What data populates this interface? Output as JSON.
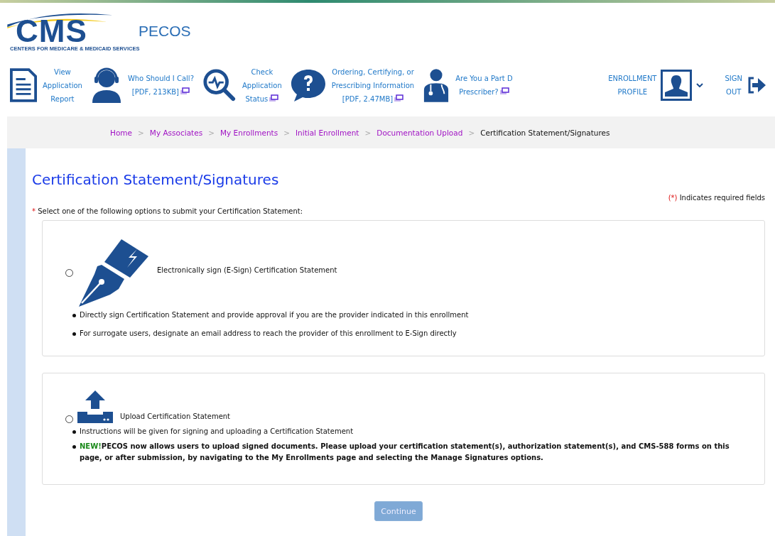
{
  "logo": {
    "letters": "CMS",
    "tagline": "CENTERS FOR MEDICARE & MEDICAID SERVICES"
  },
  "app_title": "PECOS",
  "nav": [
    {
      "kind": "document",
      "lines": [
        "View",
        "Application",
        "Report"
      ],
      "external": false
    },
    {
      "kind": "headset",
      "lines": [
        "Who Should I Call?",
        "[PDF, 213KB]"
      ],
      "external": true
    },
    {
      "kind": "status",
      "lines": [
        "Check",
        "Application",
        "Status"
      ],
      "external": true
    },
    {
      "kind": "question",
      "lines": [
        "Ordering, Certifying, or",
        "Prescribing Information",
        "[PDF, 2.47MB]"
      ],
      "external": true
    },
    {
      "kind": "doctor",
      "lines": [
        "Are You a Part D",
        "Prescriber?"
      ],
      "external": true
    }
  ],
  "profile": {
    "lines": [
      "ENROLLMENT",
      "PROFILE"
    ]
  },
  "sign_out": {
    "lines": [
      "SIGN",
      "OUT"
    ]
  },
  "breadcrumb": [
    {
      "label": "Home",
      "current": false
    },
    {
      "label": "My Associates",
      "current": false
    },
    {
      "label": "My Enrollments",
      "current": false
    },
    {
      "label": "Initial Enrollment",
      "current": false
    },
    {
      "label": "Documentation Upload",
      "current": false
    },
    {
      "label": "Certification Statement/Signatures",
      "current": true
    }
  ],
  "breadcrumb_separator": ">",
  "page_title": "Certification Statement/Signatures",
  "required_note": {
    "mark": "(*)",
    "text": "Indicates required fields"
  },
  "instruction": {
    "mark": "*",
    "text": "Select one of the following options to submit your Certification Statement:"
  },
  "options": [
    {
      "kind": "esign",
      "label": "Electronically sign (E-Sign) Certification Statement",
      "selected": false,
      "bullets": [
        {
          "text": "Directly sign Certification Statement and provide approval if you are the provider indicated in this enrollment",
          "bold": false
        },
        {
          "text": "For surrogate users, designate an email address to reach the provider of this enrollment to E-Sign directly",
          "bold": false
        }
      ]
    },
    {
      "kind": "upload",
      "label": "Upload Certification Statement",
      "selected": false,
      "bullets": [
        {
          "text": "Instructions will be given for signing and uploading a Certification Statement",
          "bold": false
        },
        {
          "tag": "NEW!",
          "text": "PECOS now allows users to upload signed documents. Please upload your certification statement(s), authorization statement(s), and CMS-588 forms on this page, or after submission, by navigating to the My Enrollments page and selecting the Manage Signatures options.",
          "bold": true
        }
      ]
    }
  ],
  "continue_button": {
    "label": "Continue",
    "disabled": true
  }
}
